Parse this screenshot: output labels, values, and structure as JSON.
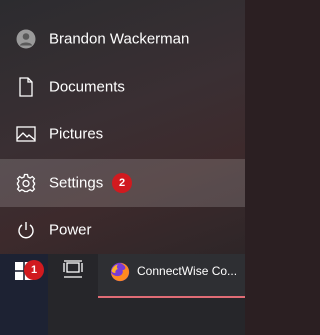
{
  "start_menu": {
    "items": [
      {
        "label": "Brandon Wackerman",
        "icon": "user-avatar-icon"
      },
      {
        "label": "Documents",
        "icon": "document-icon"
      },
      {
        "label": "Pictures",
        "icon": "pictures-icon"
      },
      {
        "label": "Settings",
        "icon": "gear-icon",
        "badge": "2"
      },
      {
        "label": "Power",
        "icon": "power-icon"
      }
    ]
  },
  "taskbar": {
    "start_badge": "1",
    "firefox_label": "ConnectWise Co..."
  },
  "colors": {
    "badge": "#d11a1f",
    "settings_highlight": "#ffffff29",
    "firefox_underline": "#e06c75"
  }
}
